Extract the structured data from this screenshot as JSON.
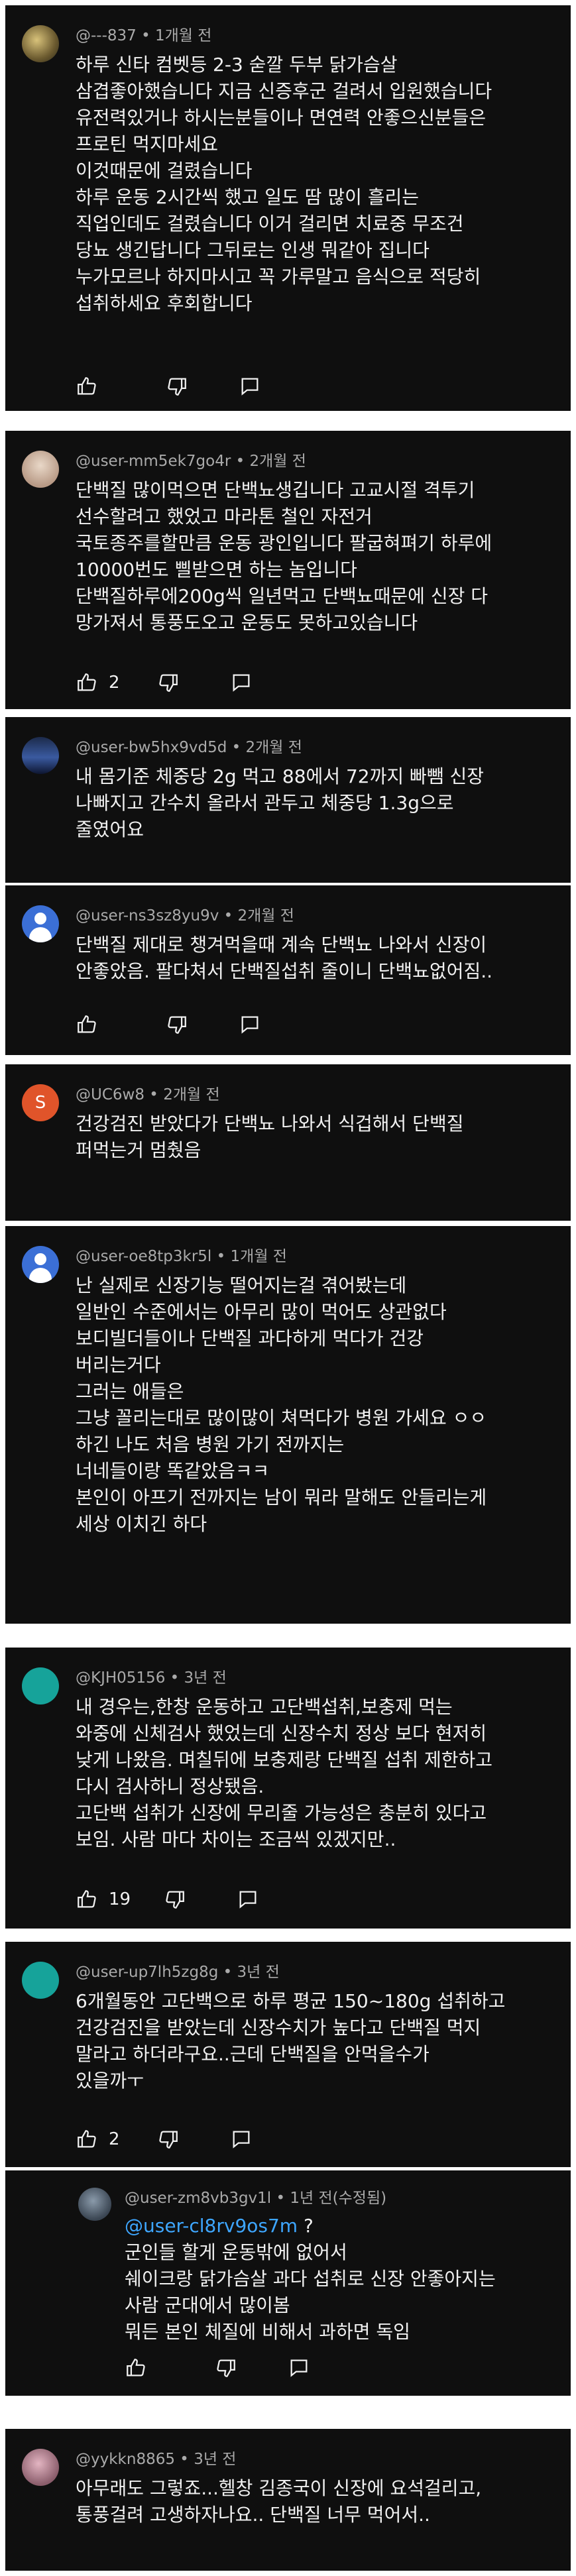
{
  "comments": [
    {
      "author": "@---837",
      "time": "1개월 전",
      "lines": [
        "하루 신타 컴벳등 2-3 숟깔 두부 닭가슴살",
        "삼겹좋아했습니다 지금 신증후군 걸려서 입원했습니다",
        "유전력있거나 하시는분들이나 면연력 안좋으신분들은",
        "프로틴 먹지마세요",
        "이것때문에 걸렸습니다",
        "하루 운동 2시간씩 했고 일도 땀 많이 흘리는",
        "직업인데도 걸렸습니다 이거 걸리면 치료중 무조건",
        "당뇨 생긴답니다 그뒤로는 인생 뭐같아 집니다",
        "누가모르나 하지마시고 꼭 가루말고 음식으로 적당히",
        "섭취하세요 후회합니다"
      ],
      "likes": ""
    },
    {
      "author": "@user-mm5ek7go4r",
      "time": "2개월 전",
      "lines": [
        "단백질 많이먹으면 단백뇨생깁니다 고교시절 격투기",
        "선수할려고 했었고 마라톤 철인 자전거",
        "국토종주를할만큼 운동 광인입니다 팔굽혀펴기 하루에",
        "10000번도 삘받으면 하는 놈입니다",
        "단백질하루에200g씩 일년먹고 단백뇨때문에 신장 다",
        "망가져서 통풍도오고  운동도 못하고있습니다"
      ],
      "likes": "2"
    },
    {
      "author": "@user-bw5hx9vd5d",
      "time": "2개월 전",
      "lines": [
        "내 몸기준 체중당 2g 먹고 88에서 72까지 빠뺌 신장",
        "나빠지고 간수치 올라서 관두고 체중당 1.3g으로",
        "줄였어요"
      ],
      "likes": ""
    },
    {
      "author": "@user-ns3sz8yu9v",
      "time": "2개월 전",
      "lines": [
        "단백질 제대로 챙겨먹을때 계속 단백뇨 나와서 신장이",
        "안좋았음. 팔다쳐서 단백질섭취 줄이니 단백뇨없어짐.."
      ],
      "likes": ""
    },
    {
      "author": "@UC6w8",
      "time": "2개월 전",
      "avatar_letter": "S",
      "lines": [
        "건강검진 받았다가 단백뇨 나와서 식겁해서 단백질",
        "퍼먹는거 멈췄음"
      ],
      "likes": ""
    },
    {
      "author": "@user-oe8tp3kr5l",
      "time": "1개월 전",
      "lines": [
        "난 실제로 신장기능 떨어지는걸 겪어봤는데",
        "일반인 수준에서는 아무리 많이 먹어도 상관없다",
        "보디빌더들이나 단백질 과다하게 먹다가 건강",
        "버리는거다",
        "그러는 애들은",
        "그냥 꼴리는대로 많이많이 쳐먹다가 병원 가세요 ㅇㅇ",
        "하긴 나도 처음 병원 가기 전까지는",
        "너네들이랑 똑같았음ㅋㅋ",
        "본인이 아프기 전까지는 남이 뭐라 말해도 안들리는게",
        "세상 이치긴 하다"
      ],
      "likes": ""
    },
    {
      "author": "@KJH05156",
      "time": "3년 전",
      "lines": [
        "내 경우는,한창 운동하고 고단백섭취,보충제 먹는",
        "와중에 신체검사 했었는데 신장수치 정상 보다 현저히",
        "낮게 나왔음. 며칠뒤에 보충제랑 단백질 섭취 제한하고",
        "다시 검사하니 정상됐음.",
        "고단백 섭취가 신장에 무리줄 가능성은 충분히 있다고",
        "보임. 사람 마다 차이는 조금씩 있겠지만.."
      ],
      "likes": "19"
    },
    {
      "author": "@user-up7lh5zg8g",
      "time": "3년 전",
      "lines": [
        "6개월동안 고단백으로 하루 평균 150~180g 섭취하고",
        "건강검진을 받았는데 신장수치가 높다고 단백질 먹지",
        "말라고 하더라구요..근데 단백질을 안먹을수가",
        "있을까ㅜ"
      ],
      "likes": "2"
    },
    {
      "author": "@user-zm8vb3gv1l",
      "time": "1년 전(수정됨)",
      "mention": "@user-cl8rv9os7m",
      "mention_suffix": " ?",
      "lines": [
        "군인들 할게 운동밖에 없어서",
        "쉐이크랑 닭가슴살 과다 섭취로 신장 안좋아지는",
        "사람 군대에서 많이봄",
        "뭐든 본인 체질에 비해서 과하면 독임"
      ],
      "likes": ""
    },
    {
      "author": "@yykkn8865",
      "time": "3년 전",
      "lines": [
        "아무래도 그렇죠...헬창 김종국이 신장에 요석걸리고,",
        "통풍걸려 고생하자나요.. 단백질 너무 먹어서.."
      ],
      "likes": ""
    }
  ],
  "separator": " • ",
  "icons": [
    "thumb-up-icon",
    "thumb-down-icon",
    "reply-icon"
  ],
  "colors": {
    "card_bg": "#0f0f0f",
    "meta": "#aaaaaa",
    "text": "#f1f1f1",
    "mention": "#3ea6ff"
  }
}
